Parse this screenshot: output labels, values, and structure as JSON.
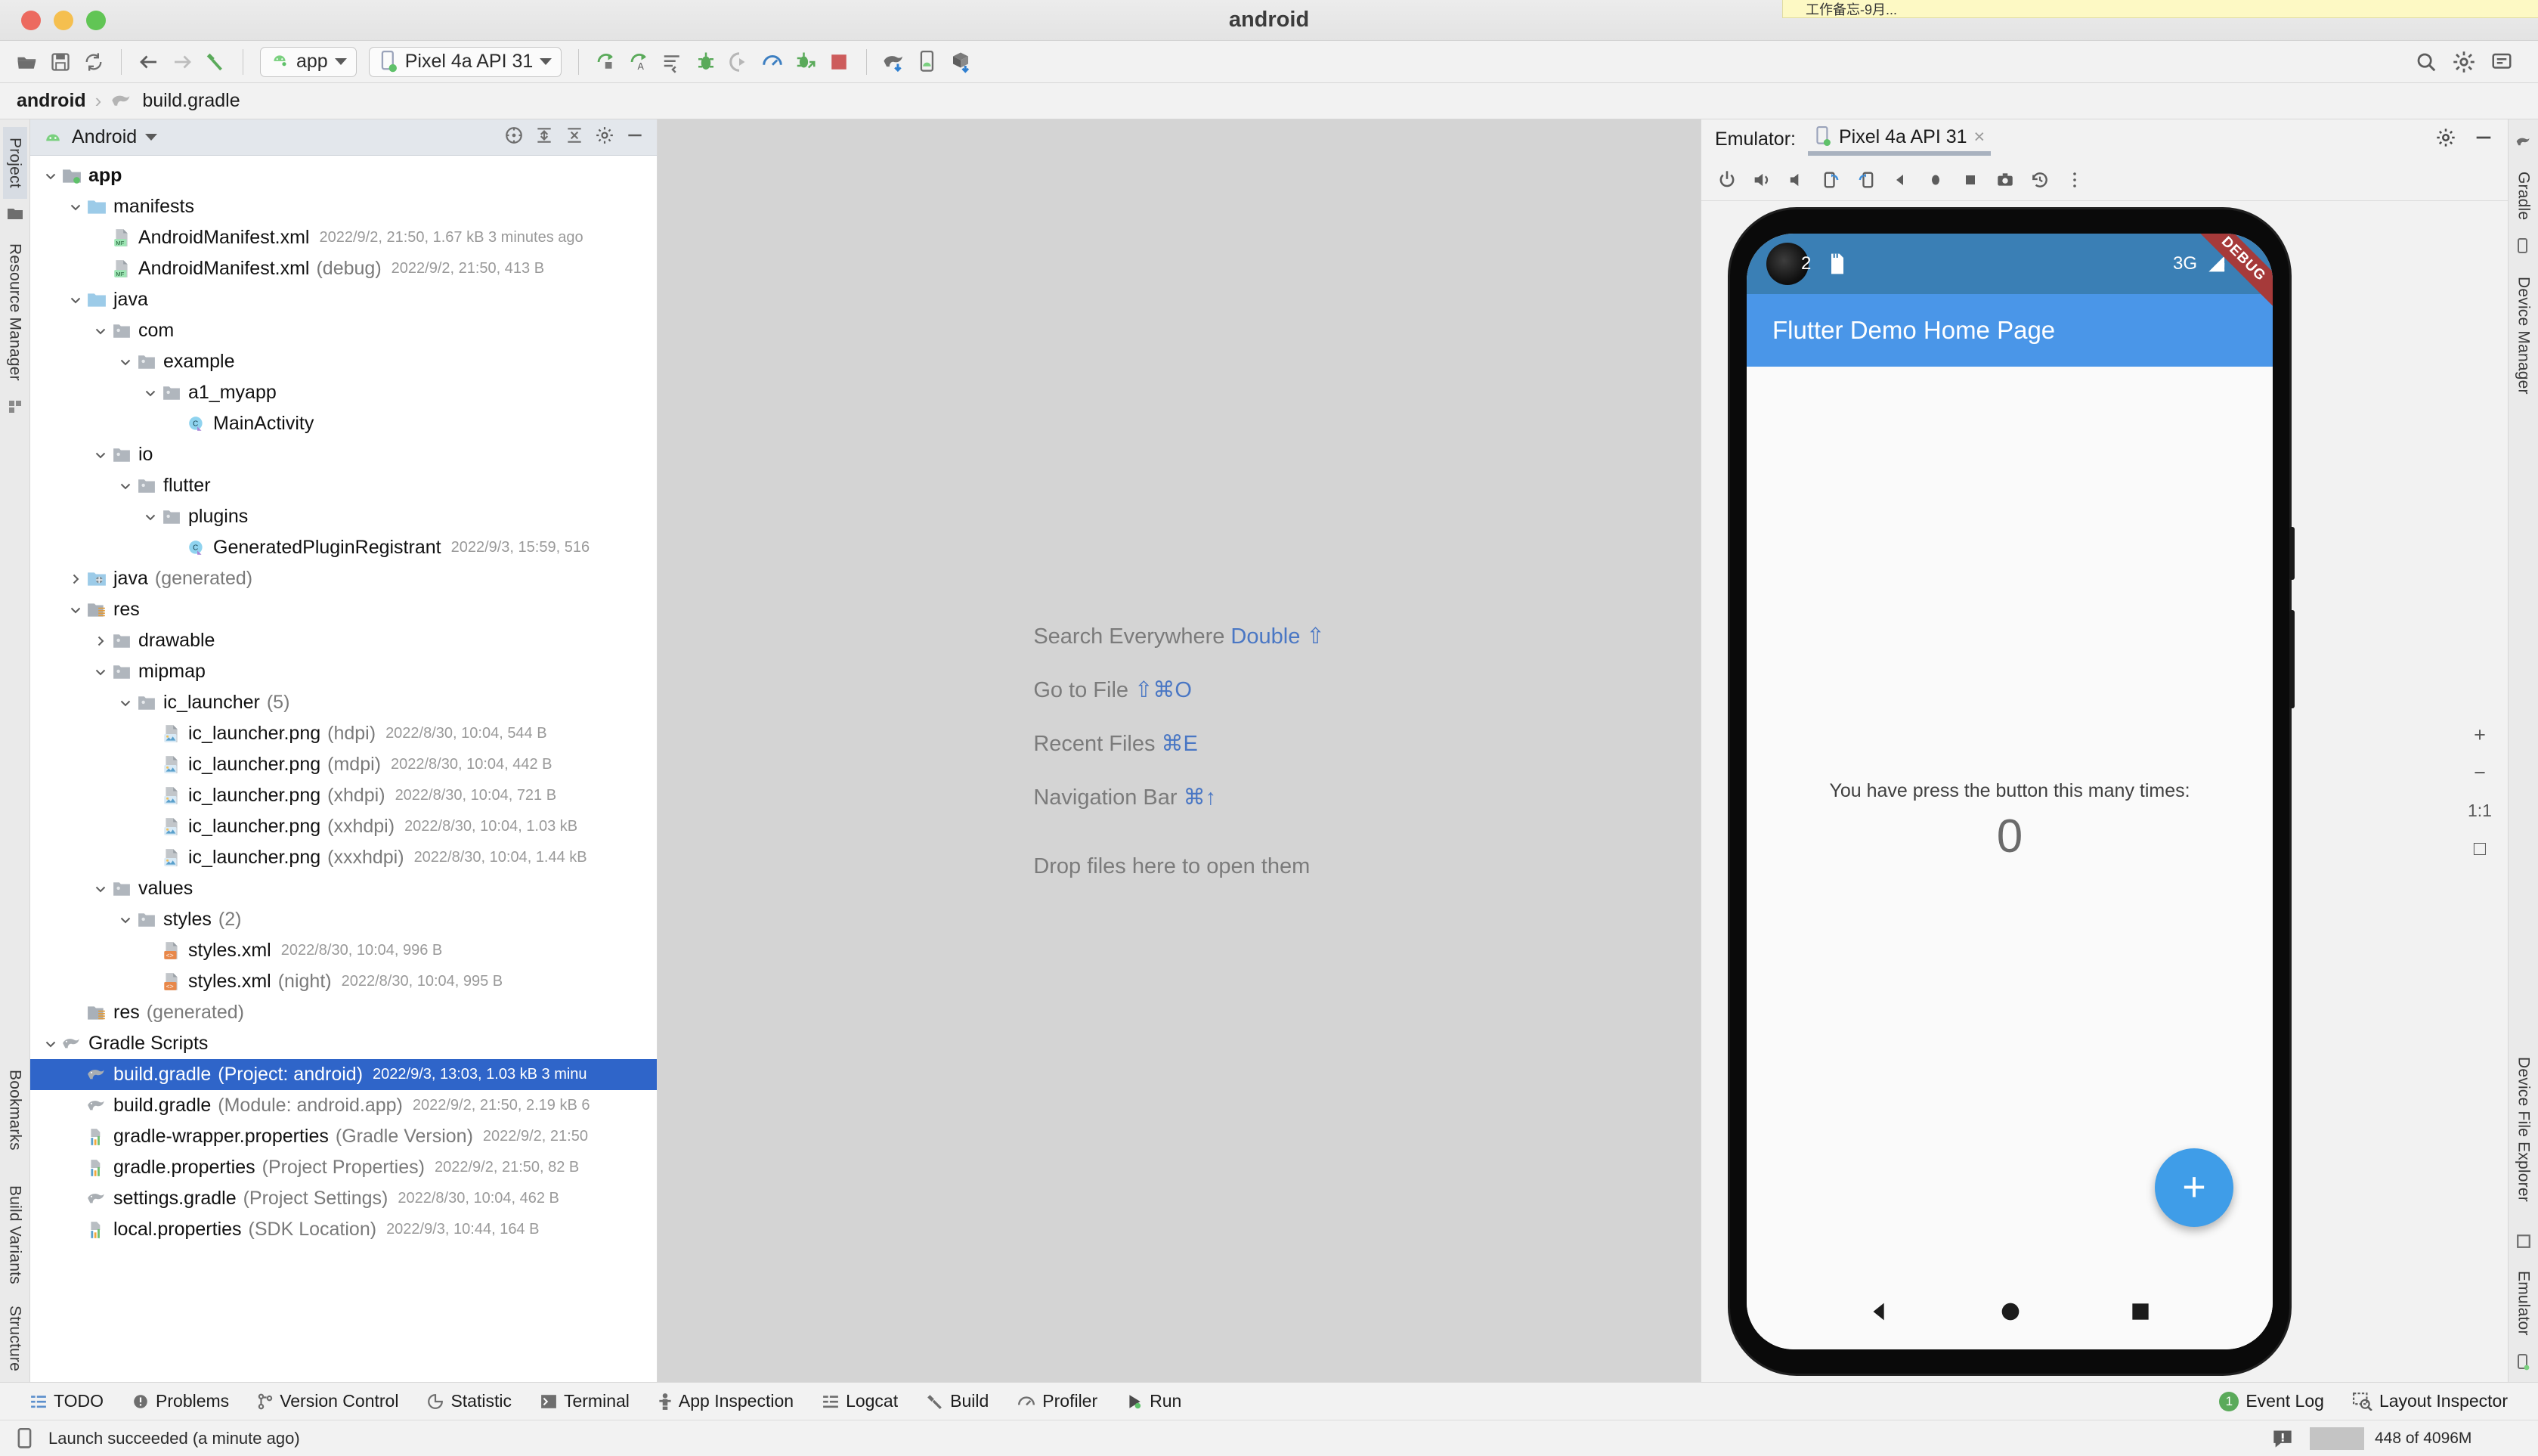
{
  "window": {
    "title": "android",
    "notification": "工作备忘-9月..."
  },
  "toolbar": {
    "open_label": "open-project",
    "save_label": "save-all",
    "sync_label": "sync-project",
    "back_label": "back",
    "forward_label": "forward",
    "build_label": "build",
    "module_combo": "app",
    "device_combo": "Pixel 4a API 31",
    "run_label": "Run",
    "run_variant_label": "Apply Changes",
    "apply_label": "Apply Code Changes",
    "debug_label": "Debug",
    "run_coverage_label": "Run with Coverage",
    "profile_label": "Profile",
    "attach_debugger_label": "Attach Debugger",
    "stop_label": "Stop",
    "gradle_sync_label": "Sync Gradle",
    "avd_label": "AVD Manager",
    "sdk_label": "SDK Manager",
    "search_label": "Search",
    "settings_label": "Settings",
    "notifications_label": "Notifications"
  },
  "breadcrumb": {
    "root": "android",
    "separator": "›",
    "leaf": "build.gradle"
  },
  "left_tool_strip": {
    "items": [
      "Project",
      "Resource Manager"
    ],
    "bottom_items": [
      "Structure",
      "Build Variants",
      "Bookmarks"
    ]
  },
  "right_tool_strip": {
    "items": [
      "Gradle",
      "Device Manager"
    ],
    "bottom_items": [
      "Emulator",
      "Device File Explorer"
    ]
  },
  "project_panel": {
    "view_name": "Android",
    "tree": [
      {
        "indent": 0,
        "arrow": "down",
        "icon": "module-icon",
        "name": "app",
        "bold": true,
        "qualifier": "",
        "meta": ""
      },
      {
        "indent": 1,
        "arrow": "down",
        "icon": "folder-blue-icon",
        "name": "manifests",
        "bold": false,
        "qualifier": "",
        "meta": ""
      },
      {
        "indent": 2,
        "arrow": "none",
        "icon": "manifest-icon",
        "name": "AndroidManifest.xml",
        "bold": false,
        "qualifier": "",
        "meta": "2022/9/2, 21:50, 1.67 kB 3 minutes ago"
      },
      {
        "indent": 2,
        "arrow": "none",
        "icon": "manifest-icon",
        "name": "AndroidManifest.xml",
        "bold": false,
        "qualifier": "(debug)",
        "meta": "2022/9/2, 21:50, 413 B"
      },
      {
        "indent": 1,
        "arrow": "down",
        "icon": "folder-blue-icon",
        "name": "java",
        "bold": false,
        "qualifier": "",
        "meta": ""
      },
      {
        "indent": 2,
        "arrow": "down",
        "icon": "package-icon",
        "name": "com",
        "bold": false,
        "qualifier": "",
        "meta": ""
      },
      {
        "indent": 3,
        "arrow": "down",
        "icon": "package-icon",
        "name": "example",
        "bold": false,
        "qualifier": "",
        "meta": ""
      },
      {
        "indent": 4,
        "arrow": "down",
        "icon": "package-icon",
        "name": "a1_myapp",
        "bold": false,
        "qualifier": "",
        "meta": ""
      },
      {
        "indent": 5,
        "arrow": "none",
        "icon": "class-icon",
        "name": "MainActivity",
        "bold": false,
        "qualifier": "",
        "meta": ""
      },
      {
        "indent": 2,
        "arrow": "down",
        "icon": "package-icon",
        "name": "io",
        "bold": false,
        "qualifier": "",
        "meta": ""
      },
      {
        "indent": 3,
        "arrow": "down",
        "icon": "package-icon",
        "name": "flutter",
        "bold": false,
        "qualifier": "",
        "meta": ""
      },
      {
        "indent": 4,
        "arrow": "down",
        "icon": "package-icon",
        "name": "plugins",
        "bold": false,
        "qualifier": "",
        "meta": ""
      },
      {
        "indent": 5,
        "arrow": "none",
        "icon": "class-icon",
        "name": "GeneratedPluginRegistrant",
        "bold": false,
        "qualifier": "",
        "meta": "2022/9/3, 15:59, 516"
      },
      {
        "indent": 1,
        "arrow": "right",
        "icon": "folder-generated-icon",
        "name": "java",
        "bold": false,
        "qualifier": "(generated)",
        "meta": ""
      },
      {
        "indent": 1,
        "arrow": "down",
        "icon": "res-folder-icon",
        "name": "res",
        "bold": false,
        "qualifier": "",
        "meta": ""
      },
      {
        "indent": 2,
        "arrow": "right",
        "icon": "package-icon",
        "name": "drawable",
        "bold": false,
        "qualifier": "",
        "meta": ""
      },
      {
        "indent": 2,
        "arrow": "down",
        "icon": "package-icon",
        "name": "mipmap",
        "bold": false,
        "qualifier": "",
        "meta": ""
      },
      {
        "indent": 3,
        "arrow": "down",
        "icon": "package-icon",
        "name": "ic_launcher",
        "bold": false,
        "qualifier": "(5)",
        "meta": ""
      },
      {
        "indent": 4,
        "arrow": "none",
        "icon": "png-icon",
        "name": "ic_launcher.png",
        "bold": false,
        "qualifier": "(hdpi)",
        "meta": "2022/8/30, 10:04, 544 B"
      },
      {
        "indent": 4,
        "arrow": "none",
        "icon": "png-icon",
        "name": "ic_launcher.png",
        "bold": false,
        "qualifier": "(mdpi)",
        "meta": "2022/8/30, 10:04, 442 B"
      },
      {
        "indent": 4,
        "arrow": "none",
        "icon": "png-icon",
        "name": "ic_launcher.png",
        "bold": false,
        "qualifier": "(xhdpi)",
        "meta": "2022/8/30, 10:04, 721 B"
      },
      {
        "indent": 4,
        "arrow": "none",
        "icon": "png-icon",
        "name": "ic_launcher.png",
        "bold": false,
        "qualifier": "(xxhdpi)",
        "meta": "2022/8/30, 10:04, 1.03 kB"
      },
      {
        "indent": 4,
        "arrow": "none",
        "icon": "png-icon",
        "name": "ic_launcher.png",
        "bold": false,
        "qualifier": "(xxxhdpi)",
        "meta": "2022/8/30, 10:04, 1.44 kB"
      },
      {
        "indent": 2,
        "arrow": "down",
        "icon": "package-icon",
        "name": "values",
        "bold": false,
        "qualifier": "",
        "meta": ""
      },
      {
        "indent": 3,
        "arrow": "down",
        "icon": "package-icon",
        "name": "styles",
        "bold": false,
        "qualifier": "(2)",
        "meta": ""
      },
      {
        "indent": 4,
        "arrow": "none",
        "icon": "xml-icon",
        "name": "styles.xml",
        "bold": false,
        "qualifier": "",
        "meta": "2022/8/30, 10:04, 996 B"
      },
      {
        "indent": 4,
        "arrow": "none",
        "icon": "xml-icon",
        "name": "styles.xml",
        "bold": false,
        "qualifier": "(night)",
        "meta": "2022/8/30, 10:04, 995 B"
      },
      {
        "indent": 1,
        "arrow": "none",
        "icon": "res-folder-icon",
        "name": "res",
        "bold": false,
        "qualifier": "(generated)",
        "meta": ""
      },
      {
        "indent": 0,
        "arrow": "down",
        "icon": "gradle-icon",
        "name": "Gradle Scripts",
        "bold": false,
        "qualifier": "",
        "meta": ""
      },
      {
        "indent": 1,
        "arrow": "none",
        "icon": "gradle-icon",
        "name": "build.gradle",
        "bold": false,
        "qualifier": "(Project: android)",
        "meta": "2022/9/3, 13:03, 1.03 kB 3 minu",
        "selected": true
      },
      {
        "indent": 1,
        "arrow": "none",
        "icon": "gradle-icon",
        "name": "build.gradle",
        "bold": false,
        "qualifier": "(Module: android.app)",
        "meta": "2022/9/2, 21:50, 2.19 kB 6"
      },
      {
        "indent": 1,
        "arrow": "none",
        "icon": "properties-icon",
        "name": "gradle-wrapper.properties",
        "bold": false,
        "qualifier": "(Gradle Version)",
        "meta": "2022/9/2, 21:50"
      },
      {
        "indent": 1,
        "arrow": "none",
        "icon": "properties-icon",
        "name": "gradle.properties",
        "bold": false,
        "qualifier": "(Project Properties)",
        "meta": "2022/9/2, 21:50, 82 B"
      },
      {
        "indent": 1,
        "arrow": "none",
        "icon": "gradle-icon",
        "name": "settings.gradle",
        "bold": false,
        "qualifier": "(Project Settings)",
        "meta": "2022/8/30, 10:04, 462 B"
      },
      {
        "indent": 1,
        "arrow": "none",
        "icon": "properties-icon",
        "name": "local.properties",
        "bold": false,
        "qualifier": "(SDK Location)",
        "meta": "2022/9/3, 10:44, 164 B"
      }
    ]
  },
  "editor": {
    "hints": [
      {
        "label": "Search Everywhere",
        "shortcut": "Double ⇧"
      },
      {
        "label": "Go to File",
        "shortcut": "⇧⌘O"
      },
      {
        "label": "Recent Files",
        "shortcut": "⌘E"
      },
      {
        "label": "Navigation Bar",
        "shortcut": "⌘↑"
      }
    ],
    "drop_hint": "Drop files here to open them"
  },
  "emulator": {
    "label": "Emulator:",
    "tab_title": "Pixel 4a API 31",
    "close_label": "×",
    "settings_label": "settings",
    "minimize_label": "minimize",
    "toolbar_buttons": [
      "power-icon",
      "volume-up-icon",
      "volume-down-icon",
      "rotate-left-icon",
      "rotate-right-icon",
      "back-icon",
      "home-icon",
      "overview-icon",
      "screenshot-icon",
      "history-icon",
      "more-icon"
    ],
    "zoom_controls": {
      "zoom_in": "+",
      "zoom_out": "−",
      "ratio": "1:1",
      "fit": "□"
    },
    "device": {
      "status_bar": {
        "time": "2",
        "network": "3G"
      },
      "debug_ribbon": "DEBUG",
      "appbar_title": "Flutter Demo Home Page",
      "counter_label": "You have press the button this many times:",
      "counter_value": "0",
      "fab_label": "+"
    }
  },
  "tool_windows": {
    "left": [
      {
        "label": "TODO",
        "icon": "list-icon"
      },
      {
        "label": "Problems",
        "icon": "problems-icon"
      },
      {
        "label": "Version Control",
        "icon": "branch-icon"
      },
      {
        "label": "Statistic",
        "icon": "pie-icon"
      },
      {
        "label": "Terminal",
        "icon": "terminal-icon"
      },
      {
        "label": "App Inspection",
        "icon": "inspection-icon"
      },
      {
        "label": "Logcat",
        "icon": "logcat-icon"
      },
      {
        "label": "Build",
        "icon": "hammer-icon"
      },
      {
        "label": "Profiler",
        "icon": "profiler-icon"
      },
      {
        "label": "Run",
        "icon": "run-icon"
      }
    ],
    "right": [
      {
        "label": "Event Log",
        "icon": "event-log-icon",
        "badge": "1"
      },
      {
        "label": "Layout Inspector",
        "icon": "layout-inspector-icon",
        "badge": ""
      }
    ]
  },
  "status_bar": {
    "message": "Launch succeeded (a minute ago)",
    "memory": "448 of 4096M"
  },
  "colors": {
    "accent_blue": "#2f65c9",
    "android_green": "#77c983",
    "appbar_blue": "#4a96e8",
    "statusbar_blue": "#3a7fb5",
    "fab_blue": "#3f9de8",
    "debug_red": "#a63a3a",
    "stop_red": "#cd5c5c"
  }
}
